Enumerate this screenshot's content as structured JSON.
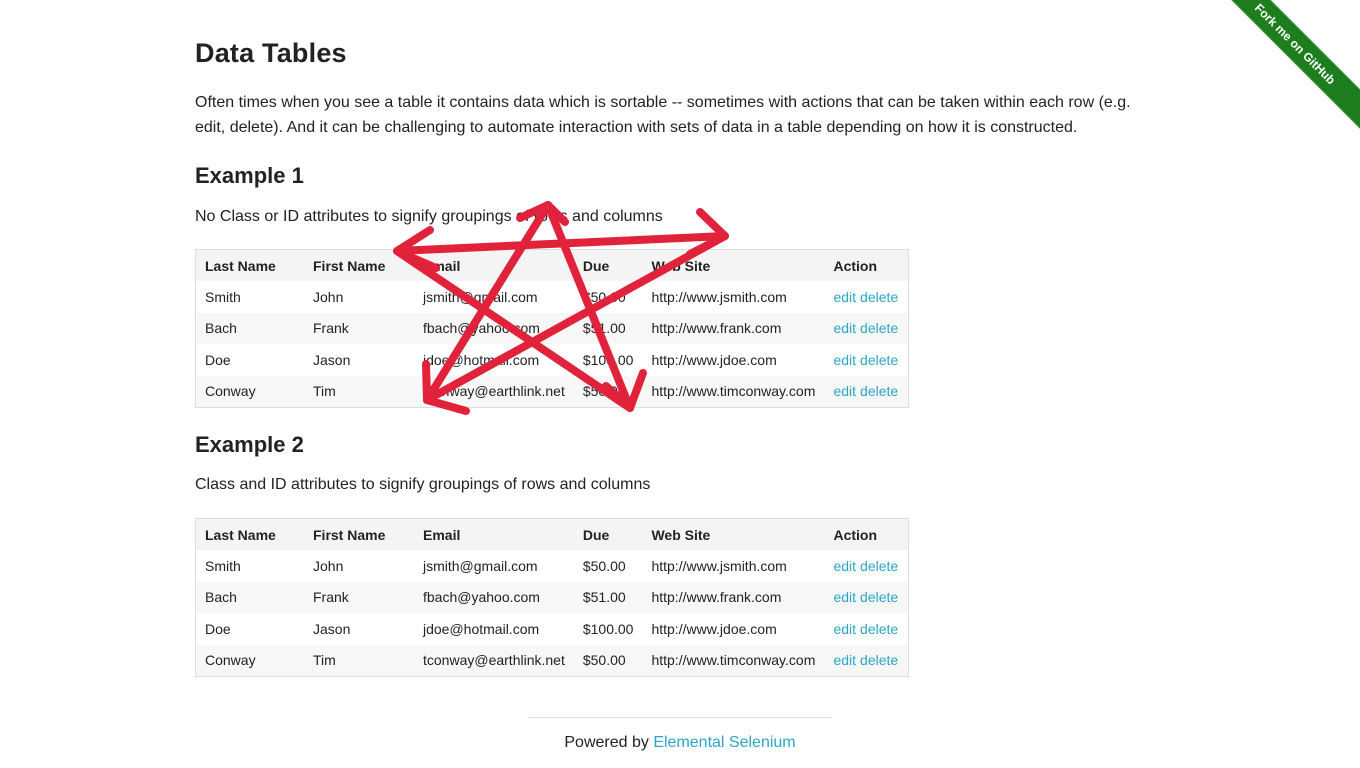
{
  "page": {
    "title": "Data Tables",
    "intro": "Often times when you see a table it contains data which is sortable -- sometimes with actions that can be taken within each row (e.g. edit, delete). And it can be challenging to automate interaction with sets of data in a table depending on how it is constructed."
  },
  "ribbon": {
    "label": "Fork me on GitHub",
    "color": "#1e7d1e"
  },
  "example1": {
    "title": "Example 1",
    "description": "No Class or ID attributes to signify groupings of rows and columns"
  },
  "example2": {
    "title": "Example 2",
    "description": "Class and ID attributes to signify groupings of rows and columns"
  },
  "table": {
    "headers": [
      "Last Name",
      "First Name",
      "Email",
      "Due",
      "Web Site",
      "Action"
    ],
    "rows": [
      {
        "last": "Smith",
        "first": "John",
        "email": "jsmith@gmail.com",
        "due": "$50.00",
        "web": "http://www.jsmith.com",
        "edit": "edit",
        "delete": "delete"
      },
      {
        "last": "Bach",
        "first": "Frank",
        "email": "fbach@yahoo.com",
        "due": "$51.00",
        "web": "http://www.frank.com",
        "edit": "edit",
        "delete": "delete"
      },
      {
        "last": "Doe",
        "first": "Jason",
        "email": "jdoe@hotmail.com",
        "due": "$100.00",
        "web": "http://www.jdoe.com",
        "edit": "edit",
        "delete": "delete"
      },
      {
        "last": "Conway",
        "first": "Tim",
        "email": "tconway@earthlink.net",
        "due": "$50.00",
        "web": "http://www.timconway.com",
        "edit": "edit",
        "delete": "delete"
      }
    ]
  },
  "footer": {
    "prefix": "Powered by",
    "link": "Elemental Selenium"
  },
  "colors": {
    "link": "#2ba6cb",
    "annotation": "#e0223a"
  }
}
